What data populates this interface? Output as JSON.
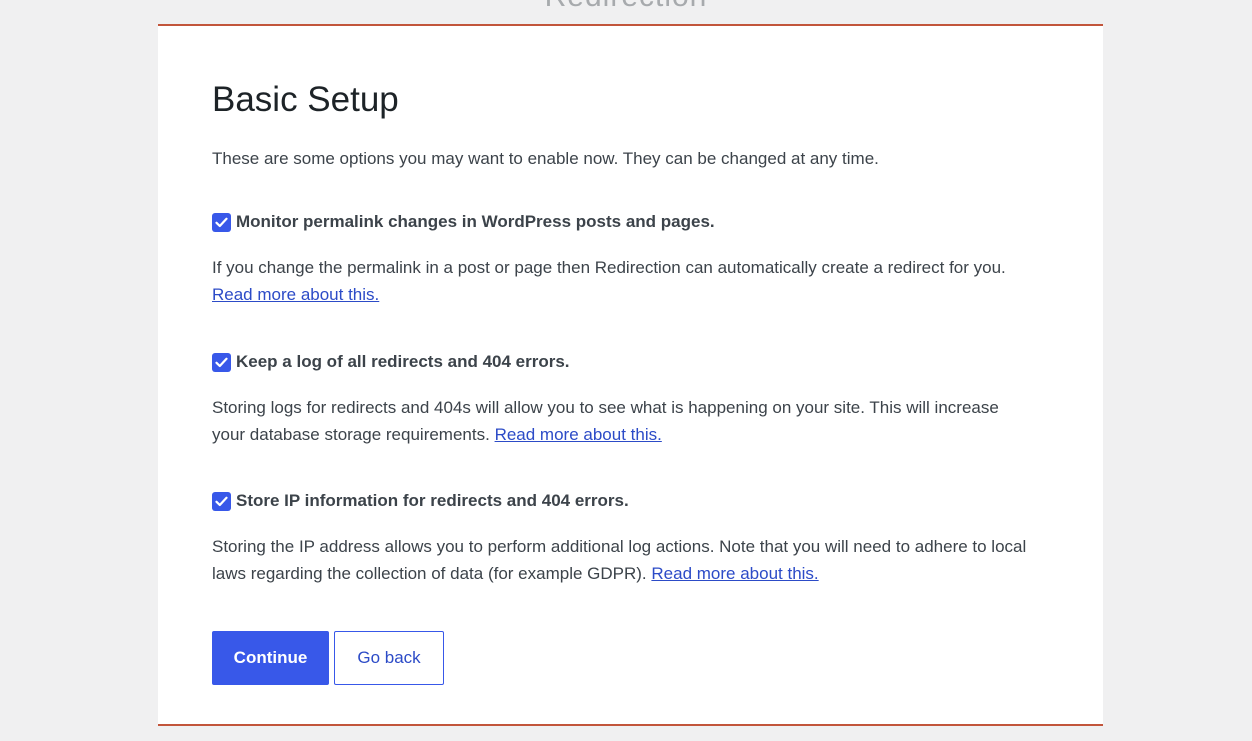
{
  "app": {
    "title": "Redirection"
  },
  "setup": {
    "heading": "Basic Setup",
    "intro": "These are some options you may want to enable now. They can be changed at any time.",
    "options": [
      {
        "label": "Monitor permalink changes in WordPress posts and pages.",
        "checked": true,
        "description": "If you change the permalink in a post or page then Redirection can automatically create a redirect for you.",
        "link": "Read more about this."
      },
      {
        "label": "Keep a log of all redirects and 404 errors.",
        "checked": true,
        "description": "Storing logs for redirects and 404s will allow you to see what is happening on your site. This will increase your database storage requirements.",
        "link": "Read more about this."
      },
      {
        "label": "Store IP information for redirects and 404 errors.",
        "checked": true,
        "description": "Storing the IP address allows you to perform additional log actions. Note that you will need to adhere to local laws regarding the collection of data (for example GDPR).",
        "link": "Read more about this."
      }
    ],
    "buttons": {
      "continue": "Continue",
      "back": "Go back"
    }
  },
  "colors": {
    "accent": "#3858e9",
    "card_border": "#c2553b",
    "background": "#f0f0f1",
    "link": "#2c4bc7"
  },
  "icons": {
    "checkbox": "checkmark-icon"
  }
}
